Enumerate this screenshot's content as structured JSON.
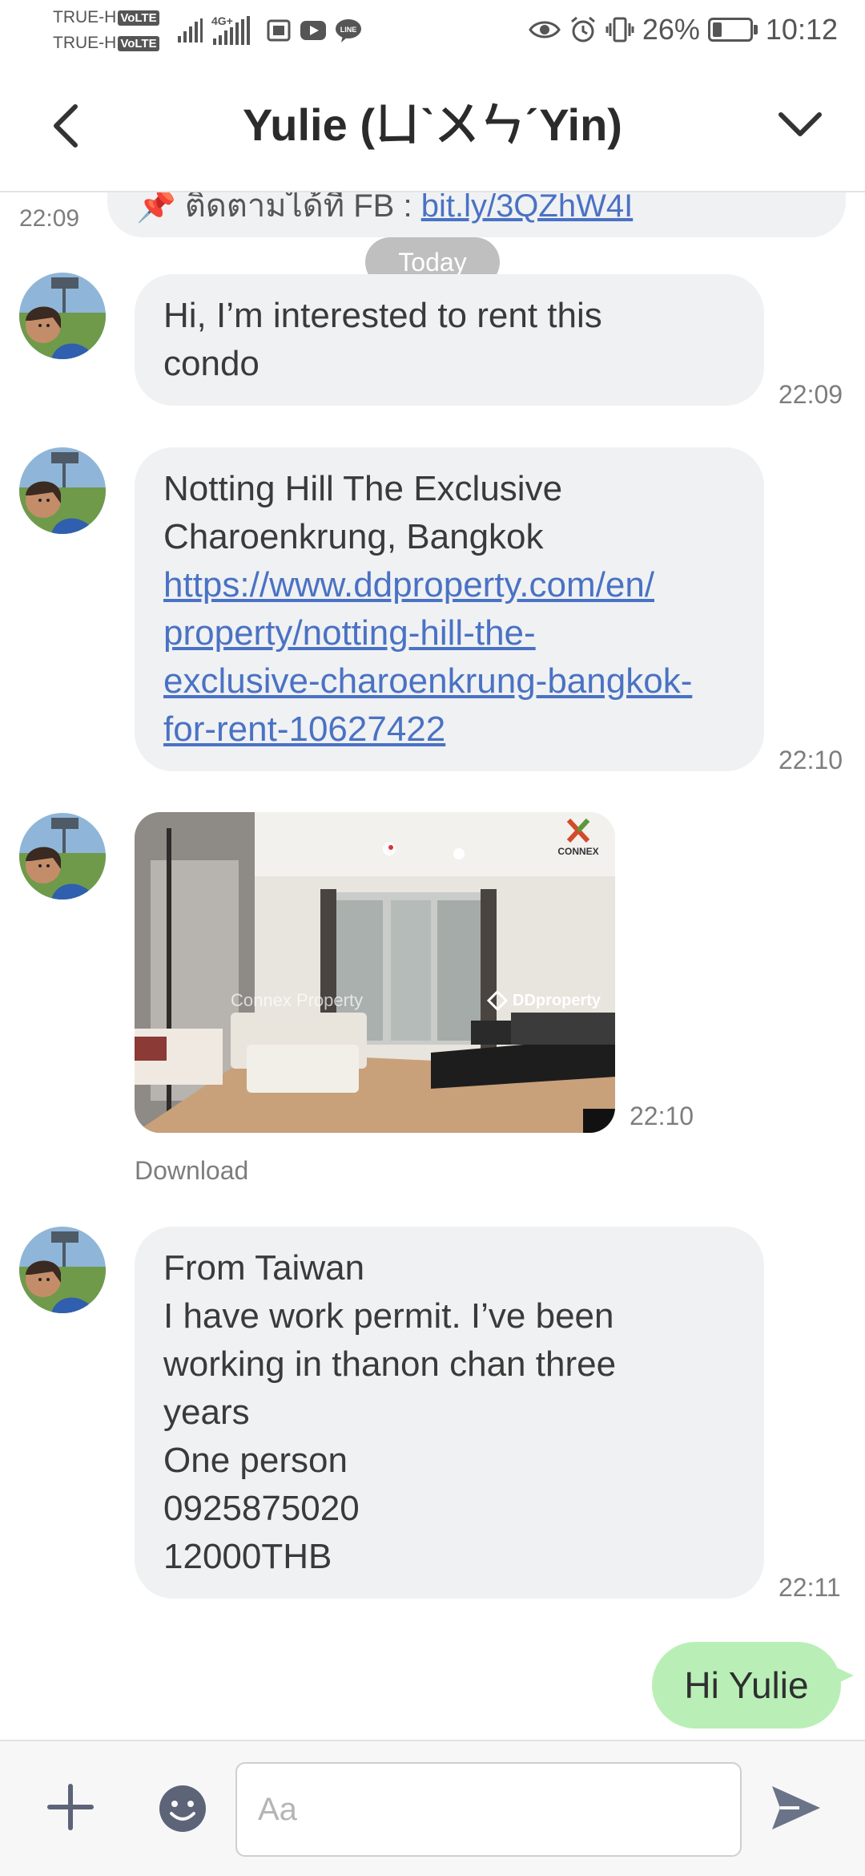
{
  "status_bar": {
    "carrier1": "TRUE-H",
    "carrier2": "TRUE-H",
    "volte": "VoLTE",
    "network_label": "4G+",
    "battery_percent": "26%",
    "battery_level": 0.26,
    "time": "10:12"
  },
  "header": {
    "title": "Yulie (ㄩˋㄨㄣˊYin)"
  },
  "previous_message": {
    "text": "📌 ติดตามได้ที่ FB : ",
    "link": "bit.ly/3QZhW4I",
    "time": "22:09"
  },
  "date_separator": "Today",
  "messages": [
    {
      "lines": [
        "Hi, I’m interested to rent this",
        "condo"
      ],
      "time": "22:09"
    },
    {
      "lines": [
        "Notting Hill The Exclusive",
        "Charoenkrung, Bangkok"
      ],
      "link_lines": [
        "https://www.ddproperty.com/en/",
        "property/notting-hill-the-",
        "exclusive-charoenkrung-bangkok-",
        "for-rent-10627422"
      ],
      "time": "22:10"
    },
    {
      "image_watermark_left": "Connex Property",
      "image_watermark_right": "DDproperty",
      "image_logo": "CONNEX",
      "time": "22:10",
      "download_label": "Download"
    },
    {
      "lines": [
        "From Taiwan",
        "I have work permit. I’ve been",
        "working in thanon chan three",
        "years",
        "One person",
        "0925875020",
        "12000THB"
      ],
      "time": "22:11"
    }
  ],
  "outgoing": {
    "text": "Hi Yulie"
  },
  "input": {
    "placeholder": "Aa",
    "value": ""
  },
  "colors": {
    "incoming_bubble": "#f0f1f3",
    "outgoing_bubble": "#b9efb6",
    "link": "#4a72c4",
    "send_icon": "#6b7389"
  }
}
